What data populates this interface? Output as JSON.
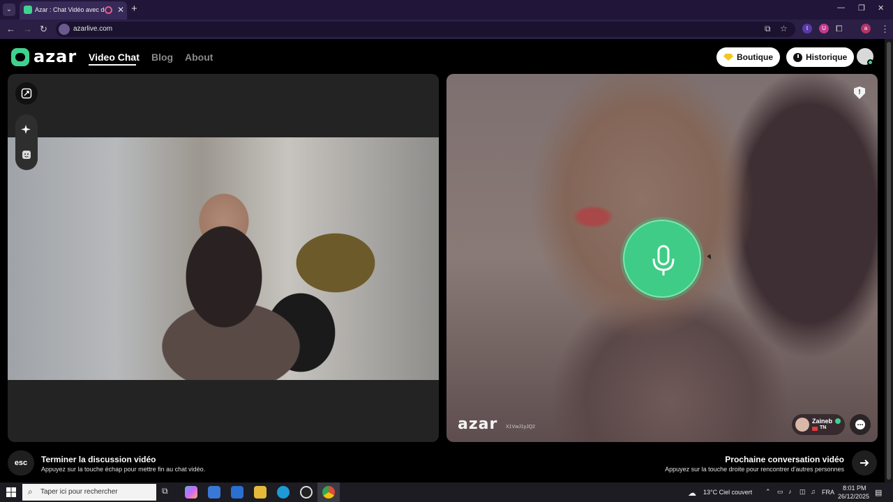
{
  "browser": {
    "tab_title": "Azar : Chat Vidéo avec de n",
    "url": "azarlive.com"
  },
  "site": {
    "brand": "azar",
    "nav": [
      {
        "label": "Video Chat",
        "active": true
      },
      {
        "label": "Blog",
        "active": false
      },
      {
        "label": "About",
        "active": false
      }
    ],
    "boutique_label": "Boutique",
    "historique_label": "Historique"
  },
  "remote": {
    "watermark": "azar",
    "session_id": "X1VwJ1yJQ2",
    "user_name": "Zaineb",
    "user_country": "TN"
  },
  "footer": {
    "esc_key": "esc",
    "end_title": "Terminer la discussion vidéo",
    "end_sub": "Appuyez sur la touche échap pour mettre fin au chat vidéo.",
    "next_title": "Prochaine conversation vidéo",
    "next_sub": "Appuyez sur la touche droite pour rencontrer d'autres personnes"
  },
  "taskbar": {
    "search_placeholder": "Taper ici pour rechercher",
    "weather": "13°C  Ciel couvert",
    "language": "FRA",
    "time": "8:01 PM",
    "date": "26/12/2025"
  },
  "colors": {
    "accent": "#3fd28e",
    "mic_green": "#3fcc86",
    "gem": "#f3c623"
  }
}
